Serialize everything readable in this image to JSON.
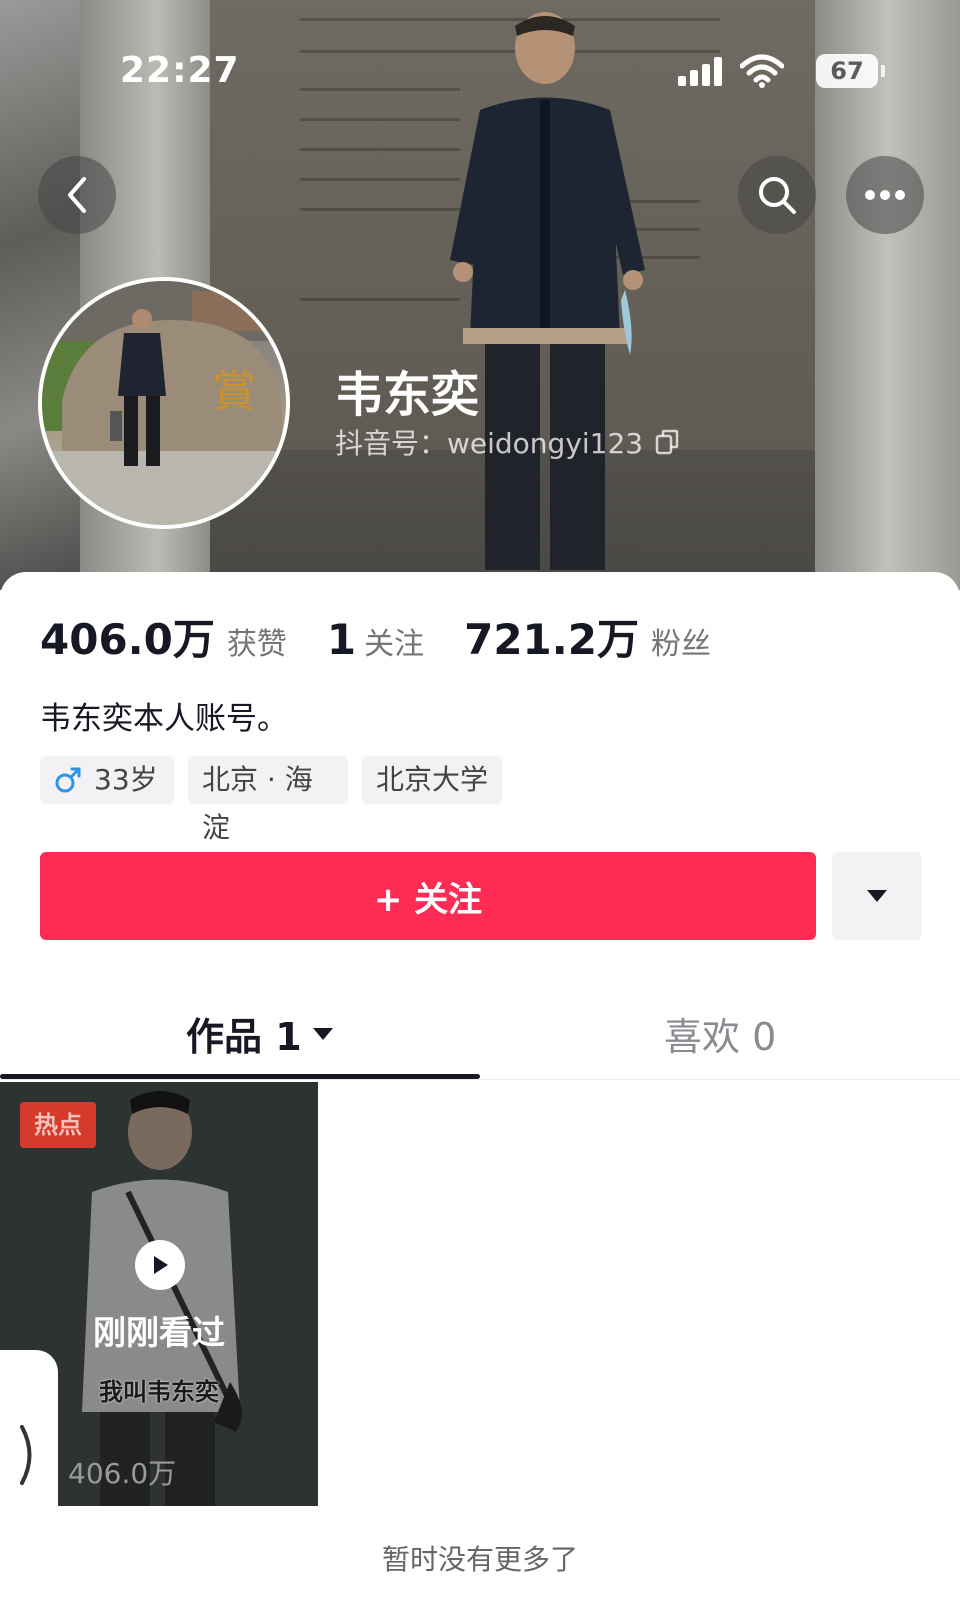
{
  "status_bar": {
    "time": "22:27",
    "battery": "67"
  },
  "profile": {
    "nickname": "韦东奕",
    "douyin_id": "抖音号：weidongyi123",
    "bio": "韦东奕本人账号。"
  },
  "stats": [
    {
      "value": "406.0万",
      "label": "获赞"
    },
    {
      "value": "1",
      "label": "关注"
    },
    {
      "value": "721.2万",
      "label": "粉丝"
    }
  ],
  "tags": {
    "age": "33岁",
    "location": "北京 · 海淀",
    "school": "北京大学"
  },
  "actions": {
    "follow_label": "+ 关注"
  },
  "tabs": {
    "works": "作品 1",
    "likes": "喜欢 0"
  },
  "video": {
    "badge": "热点",
    "watched_label": "刚刚看过",
    "caption": "我叫韦东奕",
    "like_count": "406.0万"
  },
  "footer": "暂时没有更多了",
  "colors": {
    "accent": "#fe2c55",
    "male_icon": "#2b95e9"
  },
  "icons": [
    "back-icon",
    "search-icon",
    "more-icon",
    "signal-icon",
    "wifi-icon",
    "copy-icon",
    "male-icon",
    "chevron-down-icon",
    "play-icon",
    "chevron-right-icon"
  ]
}
